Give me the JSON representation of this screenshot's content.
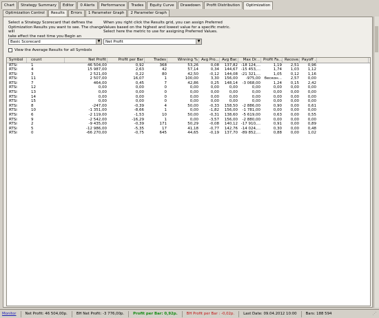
{
  "main_tabs": [
    "Chart",
    "Strategy Summary",
    "Editor",
    "0 Alerts",
    "Performance",
    "Trades",
    "Equity Curve",
    "Drawdown",
    "Profit Distribution",
    "Optimization"
  ],
  "active_main_tab": "Optimization",
  "sub_tabs": [
    "Optimization Control",
    "Results",
    "Errors",
    "1 Parameter Graph",
    "2 Parameter Graph"
  ],
  "active_sub_tab": "Results",
  "left_instructions": "Select a Strategy Scorecard that defines the\nOptimization Results you want to see. The change will\ntake effect the next time you Begin an Optimization.",
  "right_instructions": "When you right click the Results grid, you can assign Preferred\nValues based on the highest and lowest value for a specific metric.\nSelect here the metric to use for assigning Preferred Values.",
  "scorecard_select": "Basic Scorecard",
  "metric_select": "Net Profit",
  "checkbox_label": "View the Average Results for all Symbols",
  "grid": {
    "columns": [
      "Symbol",
      "count",
      "Net Profit",
      "Profit per Bar",
      "Trades",
      "Winning %",
      "Avg Pro...",
      "Avg Bar...",
      "Max Dr...",
      "Profit Fa...",
      "Recove...",
      "Payoff ..."
    ],
    "rows": [
      [
        "RTSi",
        "1",
        "46 504,00",
        "0,92",
        "368",
        "53,26",
        "0,08",
        "137,82",
        "-18 124,...",
        "1,19",
        "2,51",
        "0,96"
      ],
      [
        "RTSi",
        "4",
        "15 987,00",
        "2,63",
        "42",
        "57,14",
        "0,34",
        "144,67",
        "-15 453,...",
        "1,74",
        "1,03",
        "1,12"
      ],
      [
        "RTSi",
        "3",
        "2 521,00",
        "0,22",
        "80",
        "42,50",
        "-0,12",
        "144,08",
        "-21 321,...",
        "1,05",
        "0,12",
        "1,16"
      ],
      [
        "RTSi",
        "11",
        "2 507,00",
        "16,07",
        "1",
        "100,00",
        "3,30",
        "156,00",
        "-975,00",
        "бескон...",
        "2,57",
        "0,00"
      ],
      [
        "RTSi",
        "7",
        "464,00",
        "0,45",
        "7",
        "42,86",
        "0,25",
        "148,14",
        "-3 068,00",
        "1,24",
        "0,15",
        "2,42"
      ],
      [
        "RTSi",
        "12",
        "0,00",
        "0,00",
        "0",
        "0,00",
        "0,00",
        "0,00",
        "0,00",
        "0,00",
        "0,00",
        "0,00"
      ],
      [
        "RTSi",
        "13",
        "0,00",
        "0,00",
        "0",
        "0,00",
        "0,00",
        "0,00",
        "0,00",
        "0,00",
        "0,00",
        "0,00"
      ],
      [
        "RTSi",
        "14",
        "0,00",
        "0,00",
        "0",
        "0,00",
        "0,00",
        "0,00",
        "0,00",
        "0,00",
        "0,00",
        "0,00"
      ],
      [
        "RTSi",
        "15",
        "0,00",
        "0,00",
        "0",
        "0,00",
        "0,00",
        "0,00",
        "0,00",
        "0,00",
        "0,00",
        "0,00"
      ],
      [
        "RTSi",
        "8",
        "-247,00",
        "-0,39",
        "4",
        "50,00",
        "-0,33",
        "158,50",
        "-2 886,00",
        "0,90",
        "0,00",
        "0,61"
      ],
      [
        "RTSi",
        "10",
        "-1 351,00",
        "-8,66",
        "1",
        "0,00",
        "-1,82",
        "156,00",
        "-1 781,00",
        "0,00",
        "0,00",
        "0,00"
      ],
      [
        "RTSi",
        "6",
        "-2 119,00",
        "-1,53",
        "10",
        "50,00",
        "-0,31",
        "138,60",
        "-5 619,00",
        "0,63",
        "0,00",
        "0,55"
      ],
      [
        "RTSi",
        "9",
        "-2 542,00",
        "-16,29",
        "1",
        "0,00",
        "-3,57",
        "156,00",
        "-2 880,00",
        "0,00",
        "0,00",
        "0,00"
      ],
      [
        "RTSi",
        "2",
        "-9 435,00",
        "-0,39",
        "171",
        "50,29",
        "-0,08",
        "140,12",
        "-17 910,...",
        "0,91",
        "0,00",
        "0,89"
      ],
      [
        "RTSi",
        "5",
        "-12 986,00",
        "-5,35",
        "17",
        "41,18",
        "-0,77",
        "142,76",
        "-14 024,...",
        "0,30",
        "0,00",
        "0,48"
      ],
      [
        "RTSi",
        "0",
        "-66 270,00",
        "-0,75",
        "645",
        "44,65",
        "-0,19",
        "137,70",
        "-89 852,...",
        "0,88",
        "0,00",
        "1,02"
      ]
    ]
  },
  "status": {
    "monitor": "Monitor",
    "net_profit": "Net Profit: 46 504,00p.",
    "bh_net_profit": "BH Net Profit: -3 776,00p.",
    "profit_per_bar": "Profit per Bar: 0,92p.",
    "bh_profit_per_bar": "BH Profit per Bar : -0,02p.",
    "last_date": "Last Date: 09.04.2012 10:00",
    "bars": "Bars: 188 594"
  }
}
